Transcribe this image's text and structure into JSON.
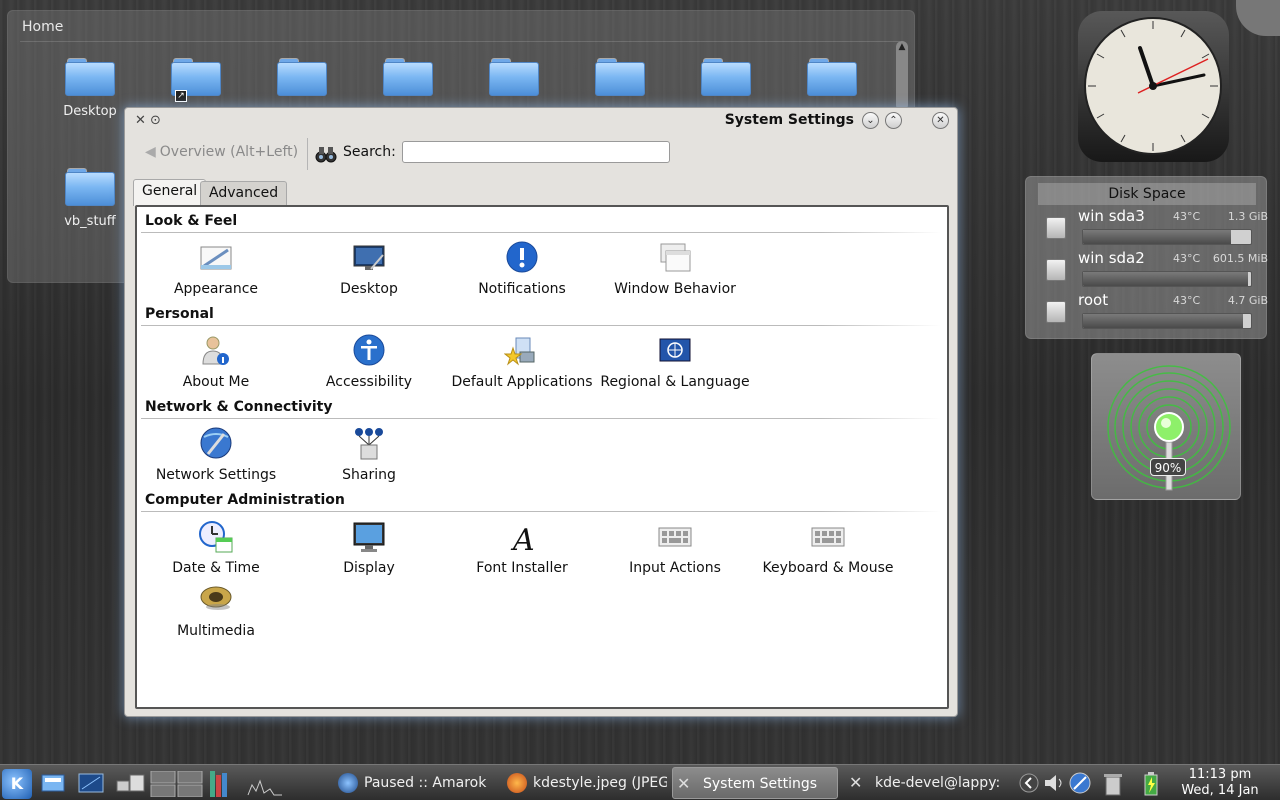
{
  "folder_view": {
    "title": "Home",
    "folders": [
      {
        "label": "Desktop"
      },
      {
        "label": ""
      },
      {
        "label": ""
      },
      {
        "label": ""
      },
      {
        "label": ""
      },
      {
        "label": ""
      },
      {
        "label": ""
      },
      {
        "label": ""
      },
      {
        "label": "vb_stuff"
      }
    ]
  },
  "disk_space": {
    "title": "Disk Space",
    "disks": [
      {
        "name": "win   sda3",
        "temp": "43°C",
        "size": "1.3 GiB",
        "used_fraction": 0.88
      },
      {
        "name": "win   sda2",
        "temp": "43°C",
        "size": "601.5 MiB",
        "used_fraction": 0.98
      },
      {
        "name": "root",
        "temp": "43°C",
        "size": "4.7 GiB",
        "used_fraction": 0.95
      }
    ]
  },
  "wifi": {
    "signal": "90%"
  },
  "window": {
    "title": "System Settings",
    "toolbar": {
      "back_label": "Overview (Alt+Left)",
      "search_label": "Search:",
      "search_value": "",
      "search_placeholder": ""
    },
    "tabs": [
      {
        "label": "General",
        "active": true
      },
      {
        "label": "Advanced",
        "active": false
      }
    ],
    "sections": [
      {
        "title": "Look & Feel",
        "items": [
          {
            "label": "Appearance",
            "icon": "appearance-icon"
          },
          {
            "label": "Desktop",
            "icon": "desktop-icon"
          },
          {
            "label": "Notifications",
            "icon": "notifications-icon"
          },
          {
            "label": "Window Behavior",
            "icon": "window-behavior-icon"
          }
        ]
      },
      {
        "title": "Personal",
        "items": [
          {
            "label": "About Me",
            "icon": "about-me-icon"
          },
          {
            "label": "Accessibility",
            "icon": "accessibility-icon"
          },
          {
            "label": "Default Applications",
            "icon": "default-applications-icon"
          },
          {
            "label": "Regional & Language",
            "icon": "regional-language-icon"
          }
        ]
      },
      {
        "title": "Network & Connectivity",
        "items": [
          {
            "label": "Network Settings",
            "icon": "network-settings-icon"
          },
          {
            "label": "Sharing",
            "icon": "sharing-icon"
          }
        ]
      },
      {
        "title": "Computer Administration",
        "items": [
          {
            "label": "Date & Time",
            "icon": "date-time-icon"
          },
          {
            "label": "Display",
            "icon": "display-icon"
          },
          {
            "label": "Font Installer",
            "icon": "font-installer-icon"
          },
          {
            "label": "Input Actions",
            "icon": "input-actions-icon"
          },
          {
            "label": "Keyboard & Mouse",
            "icon": "keyboard-mouse-icon"
          },
          {
            "label": "Multimedia",
            "icon": "multimedia-icon"
          }
        ]
      }
    ]
  },
  "taskbar": {
    "tasks": [
      {
        "label": "Paused  :: Amarok",
        "active": false
      },
      {
        "label": "kdestyle.jpeg (JPEG",
        "active": false
      },
      {
        "label": "System Settings",
        "active": true
      },
      {
        "label": "kde-devel@lappy: ~",
        "active": false
      }
    ],
    "clock_time": "11:13 pm",
    "clock_date": "Wed, 14 Jan"
  },
  "colors": {
    "window_glow": "#8cb4e6",
    "taskbar_bg": "#3a3a3a",
    "folder_blue": "#7ab6f2"
  }
}
